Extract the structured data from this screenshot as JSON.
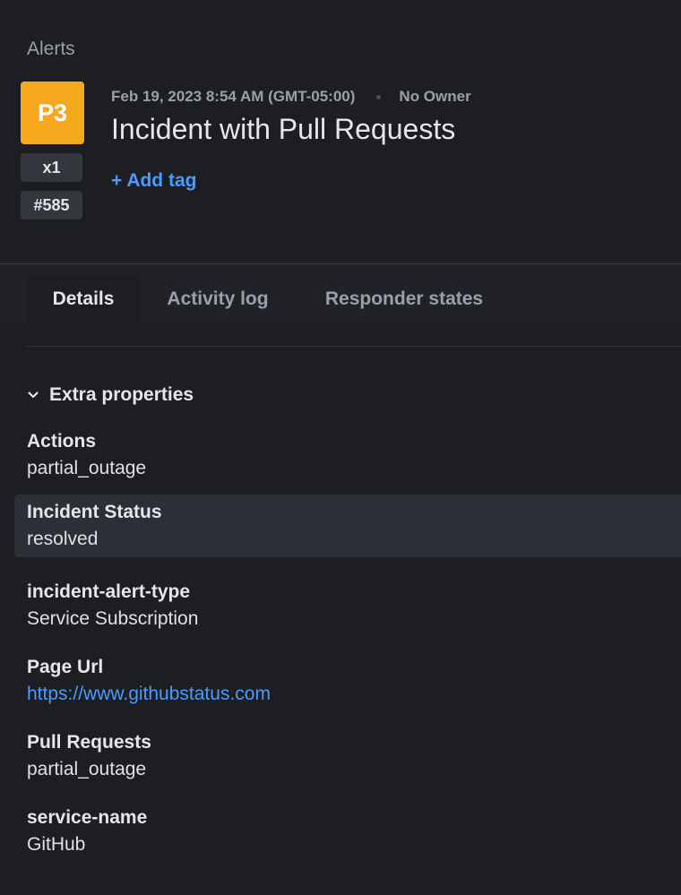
{
  "breadcrumb": "Alerts",
  "alert": {
    "priority": "P3",
    "count": "x1",
    "id": "#585",
    "timestamp": "Feb 19, 2023 8:54 AM (GMT-05:00)",
    "owner": "No Owner",
    "title": "Incident with Pull Requests",
    "add_tag_label": "+ Add tag"
  },
  "tabs": [
    {
      "label": "Details",
      "active": true
    },
    {
      "label": "Activity log",
      "active": false
    },
    {
      "label": "Responder states",
      "active": false
    }
  ],
  "extra_properties": {
    "section_label": "Extra properties",
    "items": [
      {
        "label": "Actions",
        "value": "partial_outage"
      },
      {
        "label": "Incident Status",
        "value": "resolved"
      },
      {
        "label": "incident-alert-type",
        "value": "Service Subscription"
      },
      {
        "label": "Page Url",
        "value": "https://www.githubstatus.com"
      },
      {
        "label": "Pull Requests",
        "value": "partial_outage"
      },
      {
        "label": "service-name",
        "value": "GitHub"
      }
    ]
  },
  "colors": {
    "background": "#1c1e22",
    "priority_p3": "#f5a81e",
    "link": "#4c9aff",
    "row_highlight": "#2c2f36"
  },
  "icons": {
    "section_toggle": "chevron-down-icon"
  }
}
